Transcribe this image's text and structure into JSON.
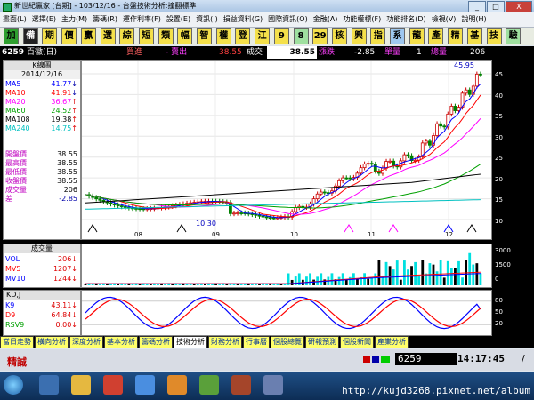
{
  "window": {
    "title": "新世紀贏家 [台期] - 103/12/16 - 台盤技術分析:撞翻標準",
    "buttons": [
      "_",
      "□",
      "X"
    ]
  },
  "menu": [
    "畫面(L)",
    "選擇(E)",
    "主力(M)",
    "籌碼(R)",
    "運作利率(F)",
    "設置(E)",
    "資訊(I)",
    "損益資料(G)",
    "國際資訊(O)",
    "金融(A)",
    "功能權標(F)",
    "功能排名(D)",
    "檢視(V)",
    "說明(H)"
  ],
  "toolbar": [
    "加",
    "備",
    "期",
    "價",
    "贏",
    "選",
    "綜",
    "短",
    "類",
    "幅",
    "智",
    "權",
    "登",
    "江",
    "9",
    "8",
    "29",
    "核",
    "興",
    "指",
    "系",
    "龍",
    "產",
    "精",
    "基",
    "技",
    "驗"
  ],
  "quote": {
    "code": "6259",
    "name": "百徽(日)",
    "buy_label": "買進",
    "sell_label": "- 賣出",
    "trade_label": "成交",
    "trade_value": "38.55",
    "price_display": "38.55",
    "change_label": "漲跌",
    "change_value": "-2.85",
    "volume_label": "單量",
    "volume_value": "1",
    "total_label": "總量",
    "total_value": "206"
  },
  "kline": {
    "header": "K線圖",
    "date": "2014/12/16",
    "ma": [
      {
        "label": "MA5",
        "value": "41.77",
        "color": "#0000ff",
        "arrow": "↓"
      },
      {
        "label": "MA10",
        "value": "41.91",
        "color": "#ff0000",
        "arrow": "↓"
      },
      {
        "label": "MA20",
        "value": "36.67",
        "color": "#ff00ff",
        "arrow": "↑"
      },
      {
        "label": "MA60",
        "value": "24.52",
        "color": "#00a000",
        "arrow": "↑"
      },
      {
        "label": "MA108",
        "value": "19.38",
        "color": "#000000",
        "arrow": "↑"
      },
      {
        "label": "MA240",
        "value": "14.75",
        "color": "#00c0c0",
        "arrow": "↑"
      }
    ],
    "prices": [
      {
        "label": "開盤價",
        "value": "38.55"
      },
      {
        "label": "最高價",
        "value": "38.55"
      },
      {
        "label": "最低價",
        "value": "38.55"
      },
      {
        "label": "收盤價",
        "value": "38.55"
      },
      {
        "label": "成交量",
        "value": "206"
      },
      {
        "label": "差",
        "value": "-2.85"
      }
    ],
    "high_label": "45.95",
    "low_label": "10.30",
    "y_ticks": [
      "45",
      "40",
      "35",
      "30",
      "25",
      "20",
      "15",
      "10"
    ],
    "x_ticks": [
      "08",
      "09",
      "10",
      "11",
      "12"
    ]
  },
  "volume": {
    "header": "成交量",
    "rows": [
      {
        "label": "VOL",
        "value": "206",
        "arrow": "↓",
        "color": "#0000ff"
      },
      {
        "label": "MV5",
        "value": "1207",
        "arrow": "↓",
        "color": "#ff0000"
      },
      {
        "label": "MV10",
        "value": "1244",
        "arrow": "↓",
        "color": "#0000ff"
      }
    ],
    "y_ticks": [
      "3000",
      "1500",
      "0"
    ]
  },
  "kd": {
    "header": "KD,J",
    "rows": [
      {
        "label": "K9",
        "value": "43.11",
        "arrow": "↓",
        "color": "#0000ff"
      },
      {
        "label": "D9",
        "value": "64.84",
        "arrow": "↓",
        "color": "#ff0000"
      },
      {
        "label": "RSV9",
        "value": "0.00",
        "arrow": "↓",
        "color": "#00a000"
      }
    ],
    "y_ticks": [
      "80",
      "50",
      "20"
    ]
  },
  "tabs": [
    "當日走勢",
    "橫向分析",
    "深度分析",
    "基本分析",
    "籌碼分析",
    "技術分析",
    "財務分析",
    "行事曆",
    "個股總覽",
    "研報預測",
    "個股新聞",
    "產業分析"
  ],
  "status": {
    "left_label": "精誠",
    "code": "6259",
    "time": "14:17:45",
    "slash": "/"
  },
  "footer_url": "http://kujd3268.pixnet.net/album"
}
